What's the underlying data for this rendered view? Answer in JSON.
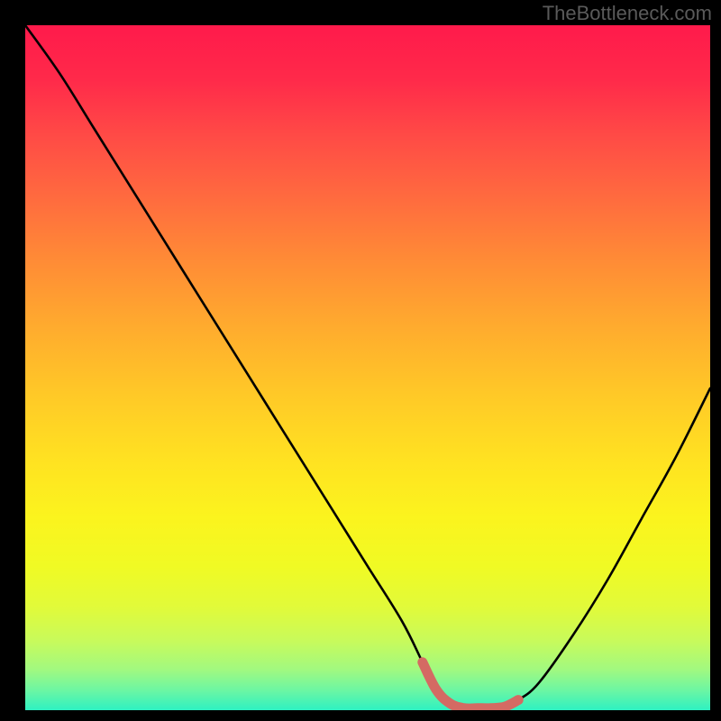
{
  "watermark": "TheBottleneck.com",
  "colors": {
    "background": "#000000",
    "curve": "#000000",
    "highlight": "#d46a63",
    "gradient_top": "#ff1a4b",
    "gradient_bottom": "#2ef1c2"
  },
  "chart_data": {
    "type": "line",
    "title": "",
    "xlabel": "",
    "ylabel": "",
    "xlim": [
      0,
      100
    ],
    "ylim": [
      0,
      100
    ],
    "x": [
      0,
      5,
      10,
      15,
      20,
      25,
      30,
      35,
      40,
      45,
      50,
      55,
      58,
      60,
      62,
      64,
      66,
      68,
      70,
      72,
      75,
      80,
      85,
      90,
      95,
      100
    ],
    "values": [
      100,
      93,
      85,
      77,
      69,
      61,
      53,
      45,
      37,
      29,
      21,
      13,
      7,
      3,
      1,
      0.3,
      0.3,
      0.3,
      0.5,
      1.5,
      4,
      11,
      19,
      28,
      37,
      47
    ],
    "highlight_range_x": [
      58,
      72
    ],
    "notes": "V-shaped bottleneck curve over a vertical red-to-green gradient. Values are percentage-of-plot-height from bottom; no axis ticks or labels are shown."
  }
}
